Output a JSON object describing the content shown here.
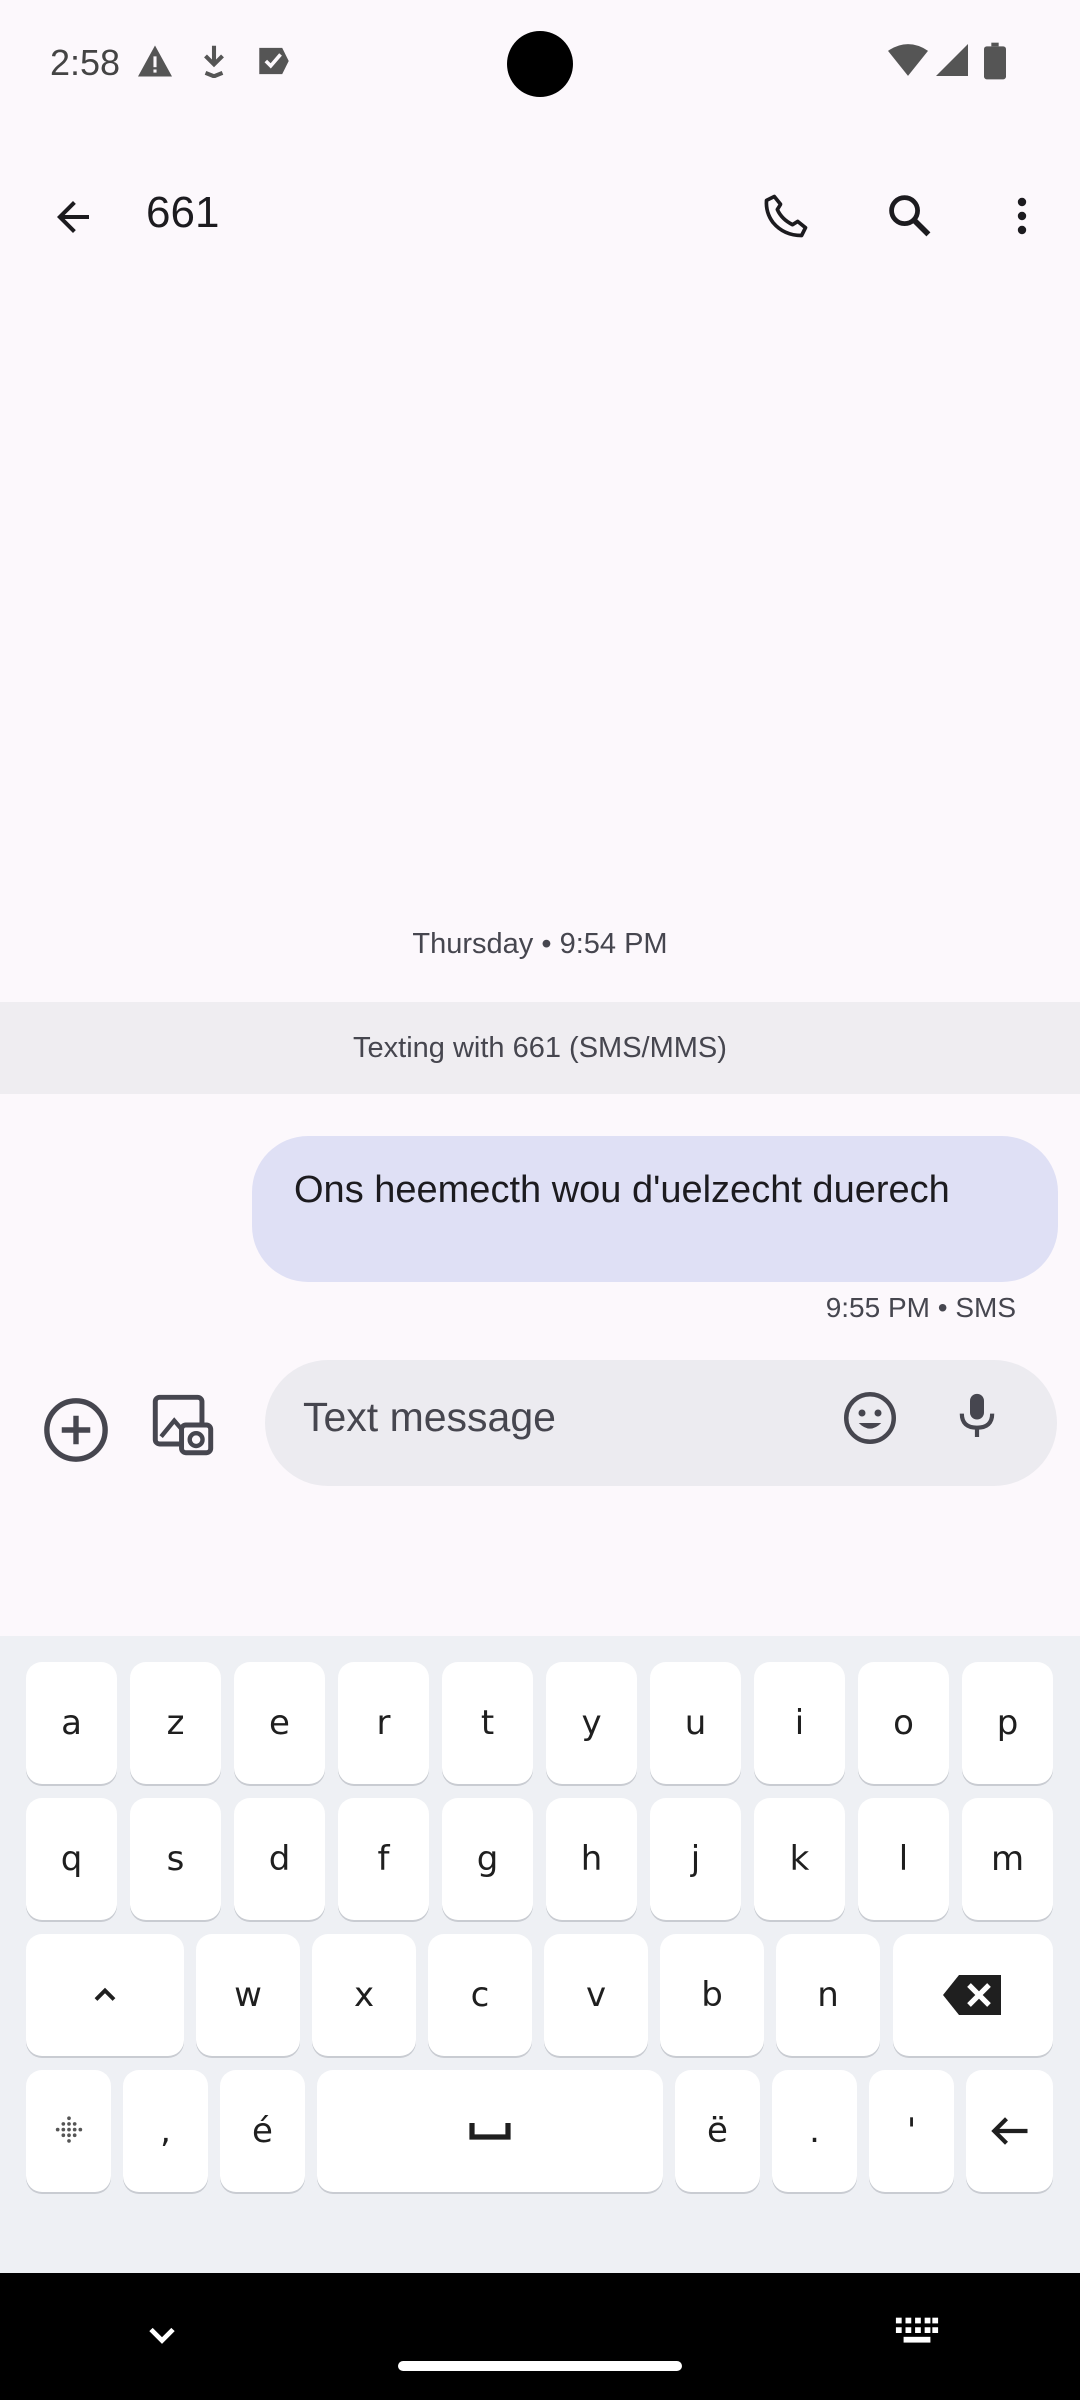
{
  "status_bar": {
    "time": "2:58",
    "left_icons": [
      "warning-icon",
      "download-icon",
      "task-check-icon"
    ],
    "right_icons": [
      "wifi-icon",
      "signal-icon",
      "battery-icon"
    ]
  },
  "app_bar": {
    "title": "661",
    "actions": [
      "phone-icon",
      "search-icon",
      "more-vert-icon"
    ]
  },
  "conversation": {
    "timestamp": "Thursday • 9:54 PM",
    "banner": "Texting with 661 (SMS/MMS)",
    "messages": [
      {
        "text": "Ons heemecth  wou d'uelzecht duerech",
        "meta": "9:55 PM • SMS",
        "direction": "outgoing"
      }
    ]
  },
  "compose": {
    "placeholder": "Text message"
  },
  "keyboard": {
    "row1": [
      "a",
      "z",
      "e",
      "r",
      "t",
      "y",
      "u",
      "i",
      "o",
      "p"
    ],
    "row2": [
      "q",
      "s",
      "d",
      "f",
      "g",
      "h",
      "j",
      "k",
      "l",
      "m"
    ],
    "row3": [
      "w",
      "x",
      "c",
      "v",
      "b",
      "n"
    ],
    "row4": [
      ",",
      "é",
      "ë",
      ".",
      "'"
    ]
  },
  "colors": {
    "background": "#fcf8fc",
    "bubble": "#dfe0f5",
    "banner": "#efedf1",
    "keyboard_bg": "#eef0f4"
  }
}
